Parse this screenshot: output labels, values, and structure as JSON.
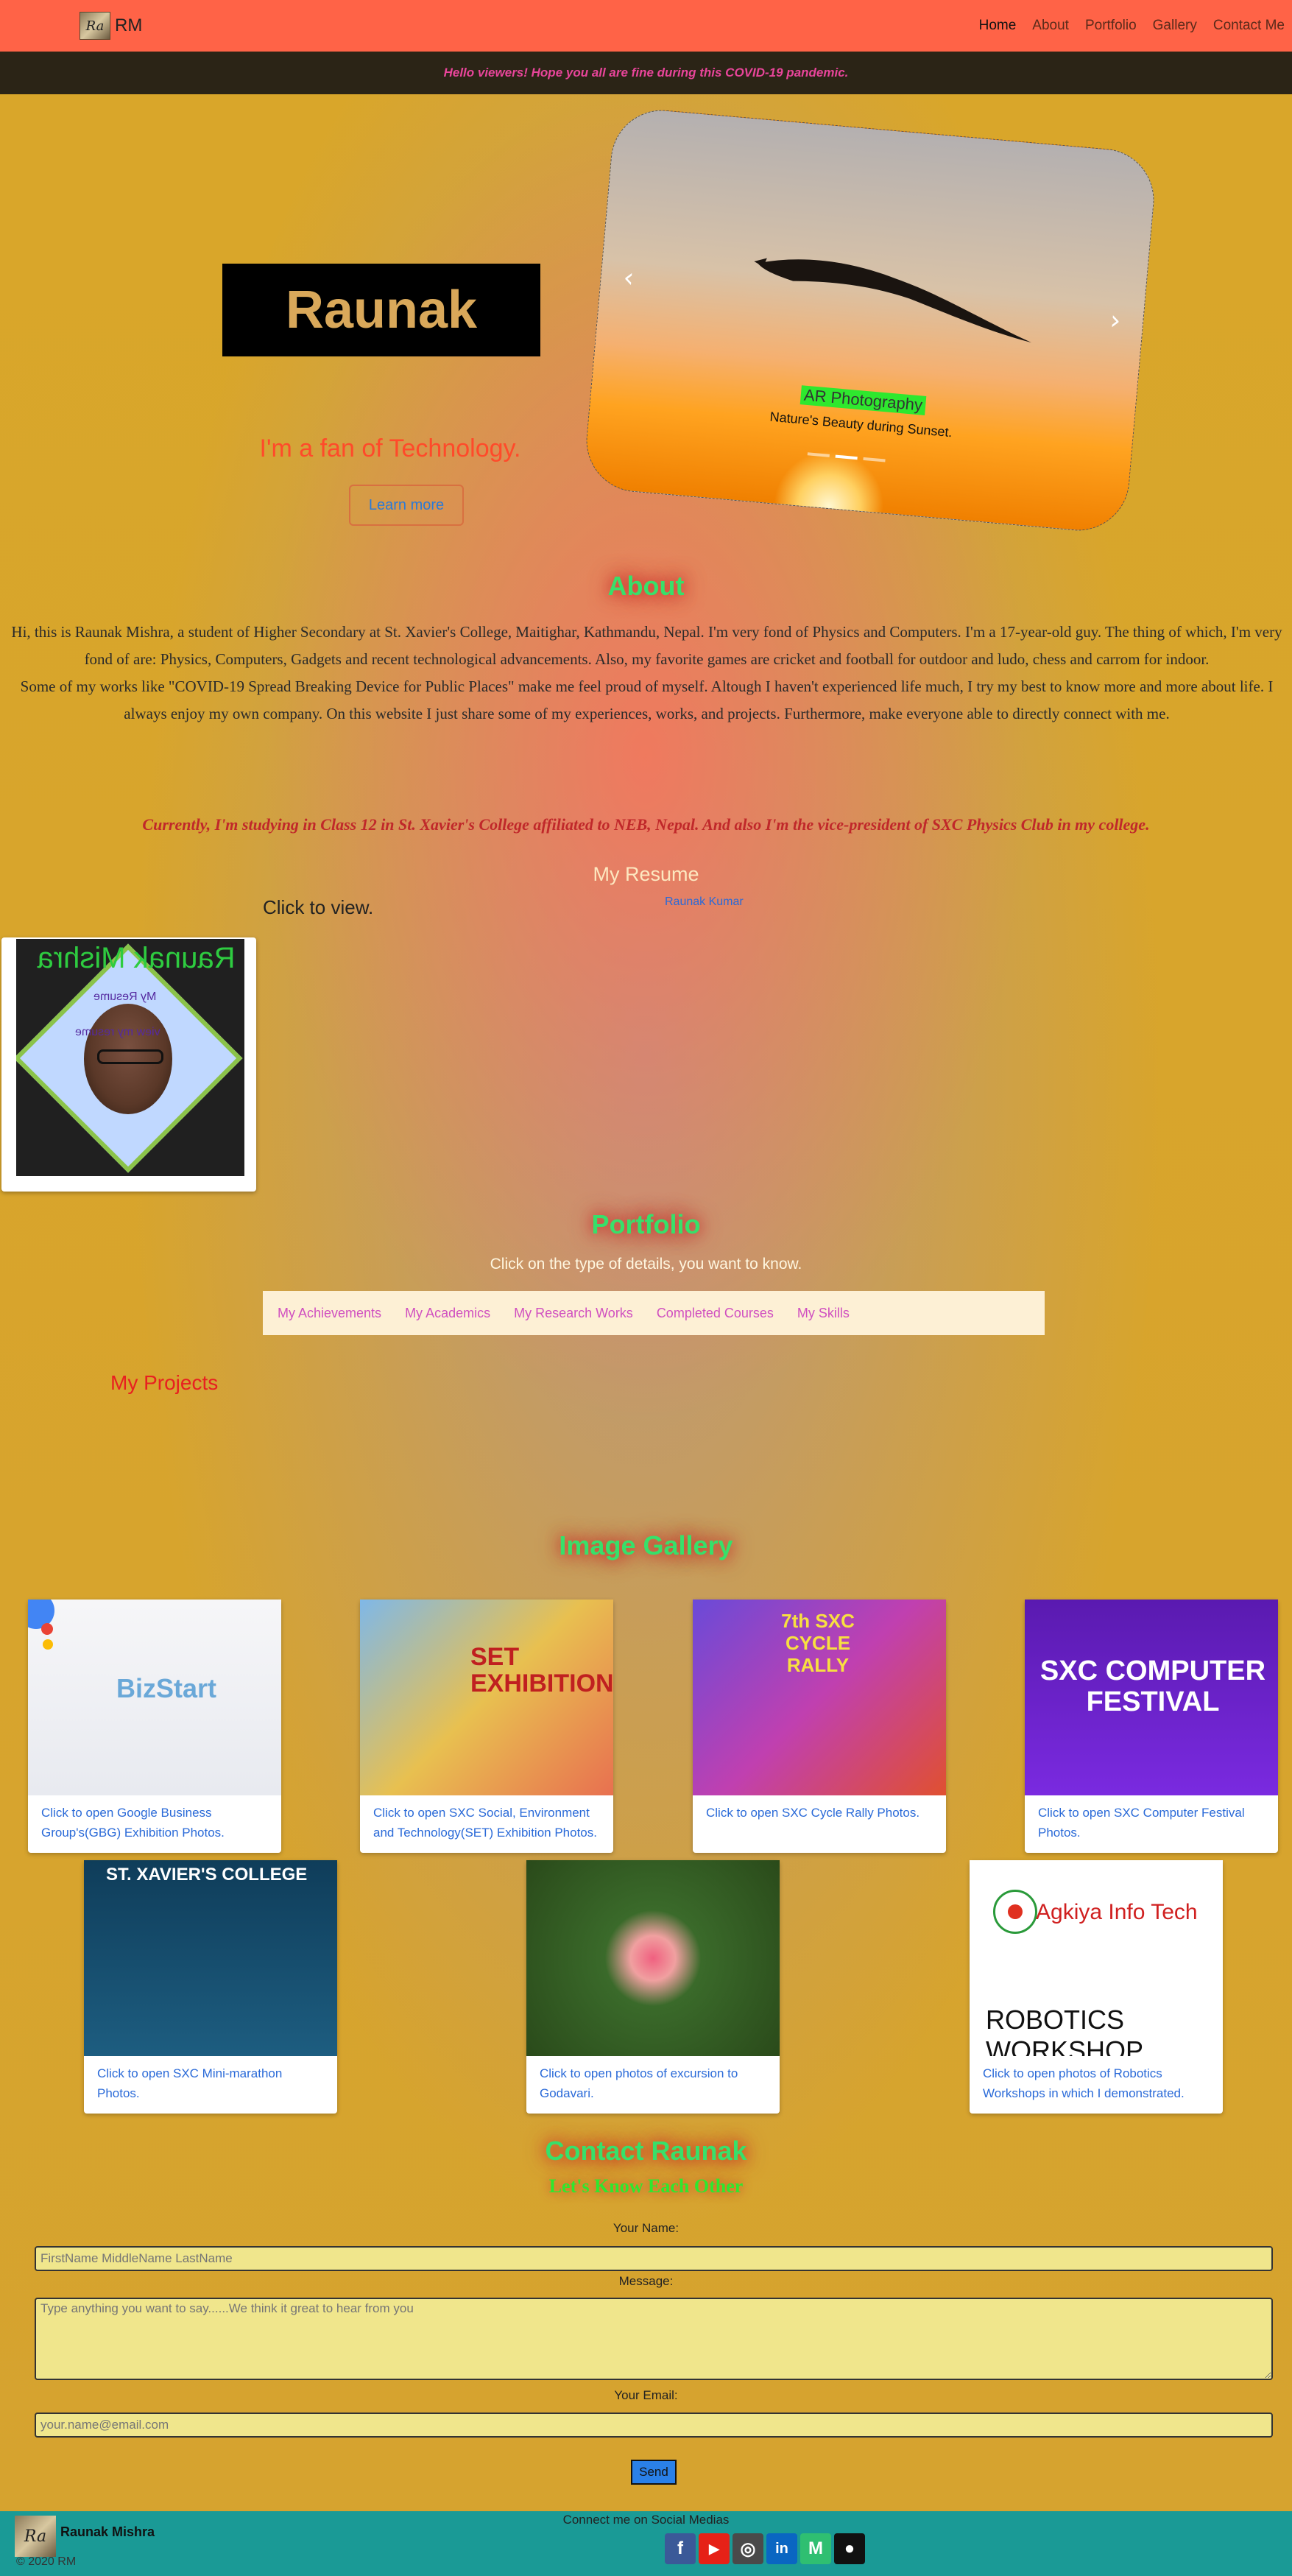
{
  "nav": {
    "brand": "RM",
    "brand_logo_glyph": "Ra",
    "links": [
      "Home",
      "About",
      "Portfolio",
      "Gallery",
      "Contact Me"
    ]
  },
  "announcement": "Hello viewers! Hope you all are fine during this COVID-19 pandemic.",
  "hero": {
    "name": "Raunak",
    "tagline": "I'm a fan of Technology.",
    "button": "Learn more"
  },
  "carousel": {
    "title": "AR Photography",
    "subtitle": "Nature's Beauty during Sunset.",
    "prev_icon": "‹",
    "next_icon": "›"
  },
  "about": {
    "title": "About",
    "p1": "Hi, this is Raunak Mishra, a student of Higher Secondary at St. Xavier's College, Maitighar, Kathmandu, Nepal. I'm very fond of Physics and Computers. I'm a 17-year-old guy. The thing of which, I'm very fond of are: Physics, Computers, Gadgets and recent technological advancements. Also, my favorite games are cricket and football for outdoor and ludo, chess and carrom for indoor.",
    "p2": "Some of my works like \"COVID-19 Spread Breaking Device for Public Places\" make me feel proud of myself. Altough I haven't experienced life much, I try my best to know more and more about life. I always enjoy my own company. On this website I just share some of my experiences, works, and projects. Furthermore, make everyone able to directly connect with me.",
    "currently": "Currently, I'm studying in Class 12 in St. Xavier's College affiliated to NEB, Nepal. And also I'm the vice-president of SXC Physics Club in my college."
  },
  "resume": {
    "title": "My Resume",
    "click": "Click to view.",
    "link": "Raunak Kumar",
    "card_name": "Raunak Mishra",
    "card_line1": "My Resume",
    "card_line2": "view my resume"
  },
  "portfolio": {
    "title": "Portfolio",
    "subtitle": "Click on the type of details, you want to know.",
    "tabs": [
      "My Achievements",
      "My Academics",
      "My Research Works",
      "Completed Courses",
      "My Skills"
    ],
    "projects": "My Projects"
  },
  "gallery": {
    "title": "Image Gallery",
    "items": [
      {
        "caption": "Click to open Google Business Group's(GBG) Exhibition Photos.",
        "img_text": "BizStart"
      },
      {
        "caption": "Click to open SXC Social, Environment and Technology(SET) Exhibition Photos.",
        "img_text": "SET EXHIBITION"
      },
      {
        "caption": "Click to open SXC Cycle Rally Photos.",
        "img_text": "7th SXC CYCLE RALLY"
      },
      {
        "caption": "Click to open SXC Computer Festival Photos.",
        "img_text": "SXC COMPUTER FESTIVAL"
      },
      {
        "caption": "Click to open SXC Mini-marathon Photos.",
        "img_text": "ST. XAVIER'S COLLEGE"
      },
      {
        "caption": "Click to open photos of excursion to Godavari.",
        "img_text": ""
      },
      {
        "caption": "Click to open photos of Robotics Workshops in which I demonstrated.",
        "img_text": "ROBOTICS WORKSHOP",
        "img_brand": "Agkiya Info Tech"
      }
    ]
  },
  "contact": {
    "title": "Contact Raunak",
    "subtitle": "Let's Know Each Other",
    "name_label": "Your Name:",
    "name_placeholder": "FirstName MiddleName LastName",
    "message_label": "Message:",
    "message_placeholder": "Type anything you want to say......We think it great to hear from you",
    "email_label": "Your Email:",
    "email_placeholder": "your.name@email.com",
    "send": "Send"
  },
  "footer": {
    "name": "Raunak Mishra",
    "copyright": "© 2020 RM",
    "connect": "Connect me on Social Medias",
    "socials": [
      {
        "name": "facebook-icon",
        "glyph": "f",
        "color": "#3b5998"
      },
      {
        "name": "youtube-icon",
        "glyph": "▶",
        "color": "#e62117"
      },
      {
        "name": "instagram-icon",
        "glyph": "◎",
        "color": "#4a4a4a"
      },
      {
        "name": "linkedin-icon",
        "glyph": "in",
        "color": "#0a66c2"
      },
      {
        "name": "medium-icon",
        "glyph": "M",
        "color": "#2fbf71"
      },
      {
        "name": "github-icon",
        "glyph": "●",
        "color": "#111111"
      }
    ]
  }
}
